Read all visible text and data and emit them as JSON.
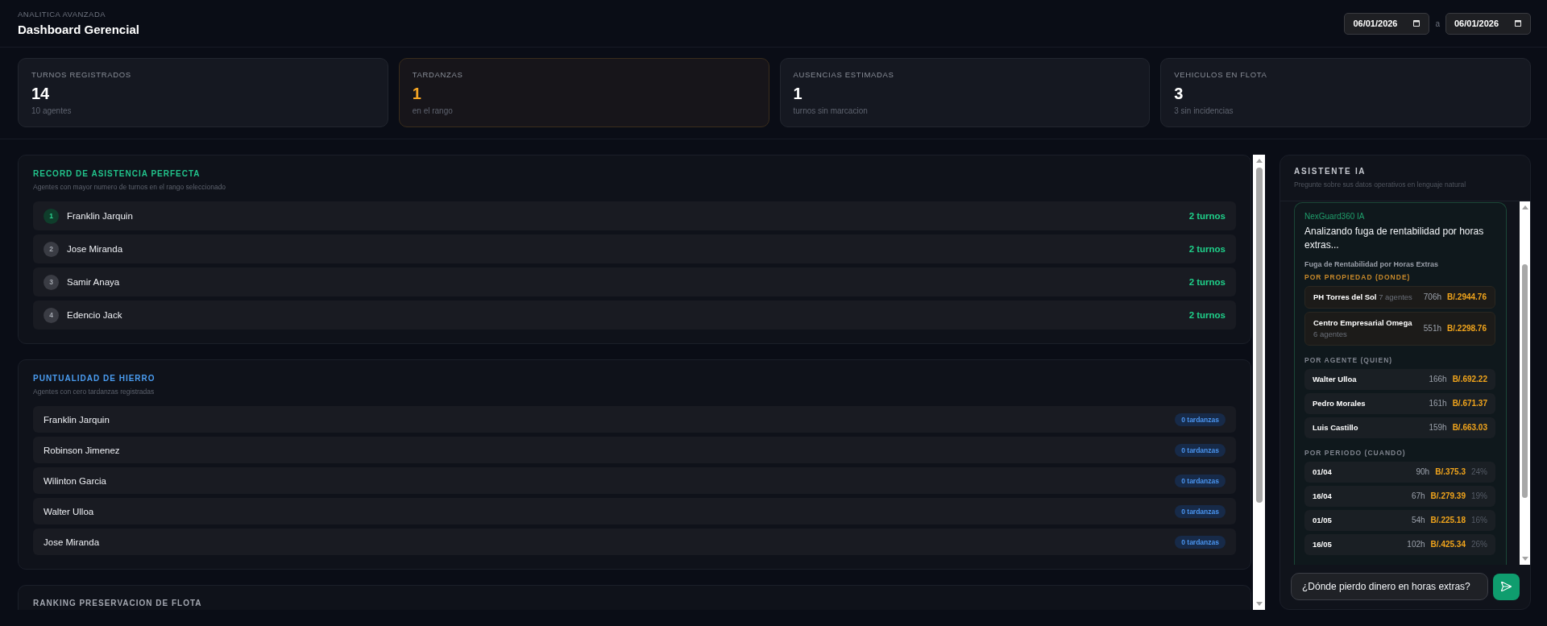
{
  "header": {
    "eyebrow": "ANALITICA AVANZADA",
    "title": "Dashboard Gerencial",
    "date_range": {
      "from": "06/01/2026",
      "separator": "a",
      "to": "06/01/2026"
    }
  },
  "stats": [
    {
      "kind": "normal",
      "label": "TURNOS REGISTRADOS",
      "value": "14",
      "note": "10 agentes"
    },
    {
      "kind": "warning",
      "label": "TARDANZAS",
      "value": "1",
      "note": "en el rango"
    },
    {
      "kind": "normal",
      "label": "AUSENCIAS ESTIMADAS",
      "value": "1",
      "note": "turnos sin marcacion"
    },
    {
      "kind": "normal",
      "label": "VEHICULOS EN FLOTA",
      "value": "3",
      "note": "3 sin incidencias"
    }
  ],
  "sections": [
    {
      "kind": "ranking",
      "color": "#22c38b",
      "title": "RECORD DE ASISTENCIA PERFECTA",
      "subtitle": "Agentes con mayor numero de turnos en el rango seleccionado",
      "rows": [
        {
          "rank": "1",
          "highlighted": true,
          "name": "Franklin Jarquin",
          "value": "2 turnos"
        },
        {
          "rank": "2",
          "highlighted": false,
          "name": "Jose Miranda",
          "value": "2 turnos"
        },
        {
          "rank": "3",
          "highlighted": false,
          "name": "Samir Anaya",
          "value": "2 turnos"
        },
        {
          "rank": "4",
          "highlighted": false,
          "name": "Edencio Jack",
          "value": "2 turnos"
        }
      ]
    },
    {
      "kind": "badges",
      "color": "#4a9cf0",
      "title": "PUNTUALIDAD DE HIERRO",
      "subtitle": "Agentes con cero tardanzas registradas",
      "rows": [
        {
          "name": "Franklin Jarquin",
          "badge": "0 tardanzas"
        },
        {
          "name": "Robinson Jimenez",
          "badge": "0 tardanzas"
        },
        {
          "name": "Wilinton Garcia",
          "badge": "0 tardanzas"
        },
        {
          "name": "Walter Ulloa",
          "badge": "0 tardanzas"
        },
        {
          "name": "Jose Miranda",
          "badge": "0 tardanzas"
        }
      ]
    },
    {
      "color": "#a3a7b0",
      "title": "RANKING PRESERVACION DE FLOTA"
    }
  ],
  "assistant": {
    "title": "ASISTENTE IA",
    "subtitle": "Pregunte sobre sus datos operativos en lenguaje natural",
    "messages": [
      {
        "sender": "NexGuard360 IA",
        "text": "Analizando fuga de rentabilidad por horas extras...",
        "report": {
          "title": "Fuga de Rentabilidad por Horas Extras",
          "groups": [
            {
              "kind": "property",
              "title": "POR PROPIEDAD (DONDE)",
              "rows": [
                {
                  "name": "PH Torres del Sol",
                  "detail": "7 agentes",
                  "hours": "706h",
                  "amount": "B/.2944.76"
                },
                {
                  "name": "Centro Empresarial Omega",
                  "detail": "6 agentes",
                  "hours": "551h",
                  "amount": "B/.2298.76"
                }
              ]
            },
            {
              "kind": "agent",
              "title": "POR AGENTE (QUIEN)",
              "rows": [
                {
                  "name": "Walter Ulloa",
                  "hours": "166h",
                  "amount": "B/.692.22"
                },
                {
                  "name": "Pedro Morales",
                  "hours": "161h",
                  "amount": "B/.671.37"
                },
                {
                  "name": "Luis Castillo",
                  "hours": "159h",
                  "amount": "B/.663.03"
                }
              ]
            },
            {
              "kind": "period",
              "title": "POR PERIODO (CUANDO)",
              "rows": [
                {
                  "name": "01/04",
                  "hours": "90h",
                  "amount": "B/.375.3",
                  "share": "24%"
                },
                {
                  "name": "16/04",
                  "hours": "67h",
                  "amount": "B/.279.39",
                  "share": "19%"
                },
                {
                  "name": "01/05",
                  "hours": "54h",
                  "amount": "B/.225.18",
                  "share": "16%"
                },
                {
                  "name": "16/05",
                  "hours": "102h",
                  "amount": "B/.425.34",
                  "share": "26%"
                }
              ]
            }
          ]
        }
      }
    ],
    "input": {
      "value": "¿Dónde pierdo dinero en horas extras?"
    }
  }
}
